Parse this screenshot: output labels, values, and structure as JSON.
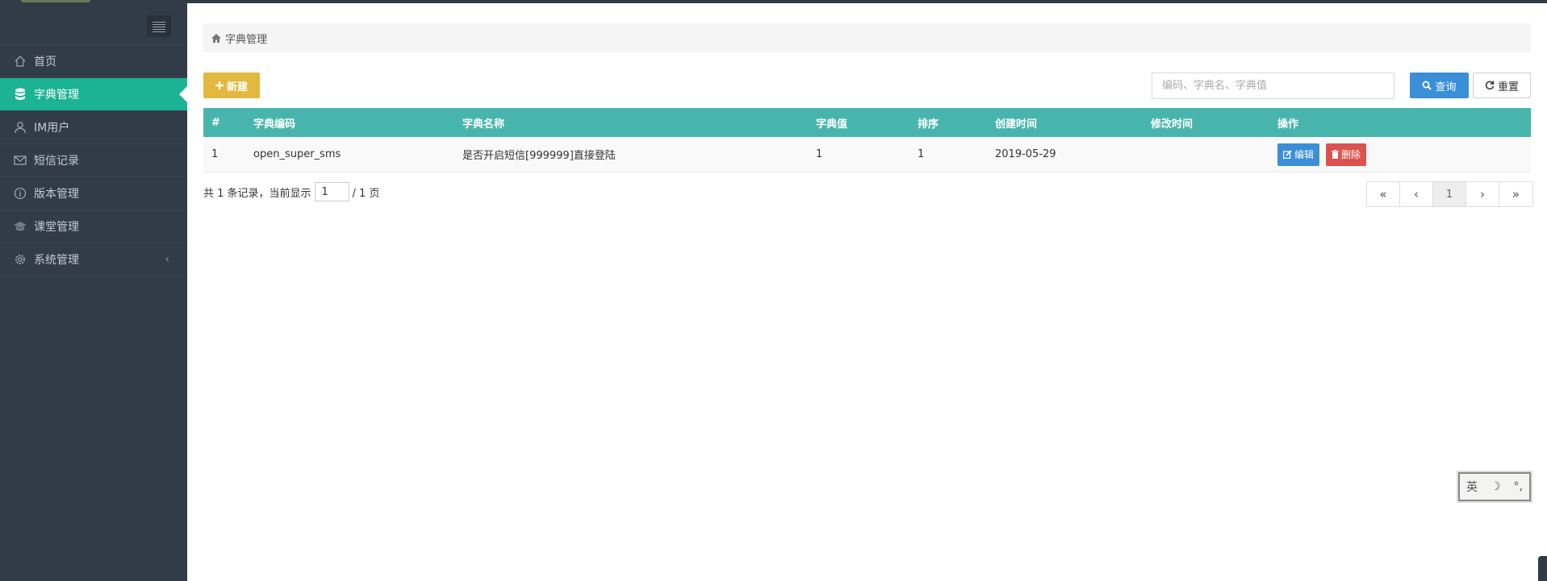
{
  "sidebar": {
    "items": [
      {
        "label": "首页",
        "icon": "home-icon",
        "active": false
      },
      {
        "label": "字典管理",
        "icon": "database-icon",
        "active": true
      },
      {
        "label": "IM用户",
        "icon": "user-icon",
        "active": false
      },
      {
        "label": "短信记录",
        "icon": "envelope-icon",
        "active": false
      },
      {
        "label": "版本管理",
        "icon": "info-circle-icon",
        "active": false
      },
      {
        "label": "课堂管理",
        "icon": "graduation-cap-icon",
        "active": false
      },
      {
        "label": "系统管理",
        "icon": "gear-icon",
        "active": false,
        "expandable": true
      }
    ],
    "chevron": "‹"
  },
  "breadcrumb": {
    "label": "字典管理"
  },
  "toolbar": {
    "new_label": "新建",
    "search_placeholder": "编码、字典名、字典值",
    "query_label": "查询",
    "reset_label": "重置"
  },
  "table": {
    "headers": [
      "#",
      "字典编码",
      "字典名称",
      "字典值",
      "排序",
      "创建时间",
      "修改时间",
      "操作"
    ],
    "rows": [
      {
        "index": "1",
        "code": "open_super_sms",
        "name": "是否开启短信[999999]直接登陆",
        "value": "1",
        "sort": "1",
        "created": "2019-05-29",
        "modified": "",
        "edit_label": "编辑",
        "delete_label": "删除"
      }
    ]
  },
  "pager": {
    "prefix": "共 1 条记录，当前显示",
    "current": "1",
    "suffix": "/ 1 页",
    "first": "«",
    "prev": "‹",
    "page": "1",
    "next": "›",
    "last": "»"
  },
  "ime": {
    "lang": "英",
    "moon": "☽",
    "punct": "°,"
  },
  "colors": {
    "sidebar": "#323c48",
    "active": "#1cb394",
    "header": "#48b5ac",
    "primary": "#3a8fd8",
    "danger": "#d9534f",
    "warning": "#e2b83f"
  }
}
